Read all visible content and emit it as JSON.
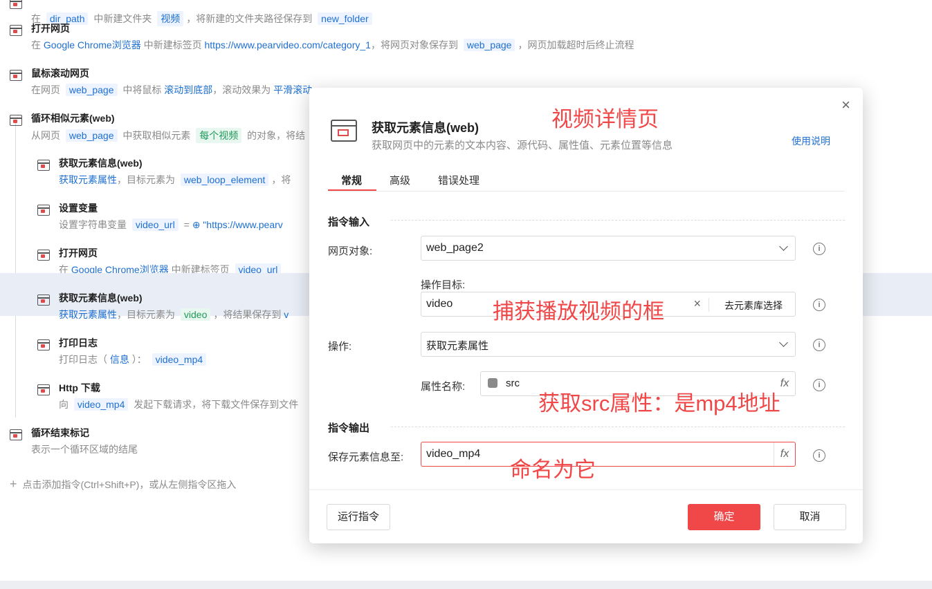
{
  "steps": [
    {
      "title": "",
      "desc": [
        {
          "t": "在 "
        },
        {
          "tag": "dir_path"
        },
        {
          "t": " 中新建文件夹 "
        },
        {
          "tag": "视频"
        },
        {
          "t": "，将新建的文件夹路径保存到 "
        },
        {
          "tag": "new_folder"
        }
      ]
    },
    {
      "title": "打开网页",
      "desc": [
        {
          "t": "在 "
        },
        {
          "lnk": "Google Chrome浏览器"
        },
        {
          "t": " 中新建标签页 "
        },
        {
          "lnk": "https://www.pearvideo.com/category_1"
        },
        {
          "t": "，将网页对象保存到 "
        },
        {
          "tag": "web_page"
        },
        {
          "t": "，网页加载超时后终止流程"
        }
      ]
    },
    {
      "title": "鼠标滚动网页",
      "desc": [
        {
          "t": "在网页 "
        },
        {
          "tag": "web_page"
        },
        {
          "t": " 中将鼠标 "
        },
        {
          "lnk": "滚动到底部"
        },
        {
          "t": "，滚动效果为 "
        },
        {
          "lnk": "平滑滚动"
        }
      ]
    },
    {
      "title": "循环相似元素(web)",
      "desc": [
        {
          "t": "从网页 "
        },
        {
          "tag": "web_page"
        },
        {
          "t": " 中获取相似元素 "
        },
        {
          "tagg": "每个视频"
        },
        {
          "t": " 的对象，将结"
        }
      ]
    },
    {
      "title": "获取元素信息(web)",
      "desc": [
        {
          "lnk": "获取元素属性"
        },
        {
          "t": "，目标元素为 "
        },
        {
          "tag": "web_loop_element"
        },
        {
          "t": "，将"
        }
      ]
    },
    {
      "title": "设置变量",
      "desc": [
        {
          "t": "设置字符串变量 "
        },
        {
          "tag": "video_url"
        },
        {
          "t": " = "
        },
        {
          "lnk": "⊕ \"https://www.pearv"
        }
      ]
    },
    {
      "title": "打开网页",
      "desc": [
        {
          "t": "在 "
        },
        {
          "lnk": "Google Chrome浏览器"
        },
        {
          "t": " 中新建标签页 "
        },
        {
          "tag": "video_url"
        }
      ]
    },
    {
      "title": "获取元素信息(web)",
      "desc": [
        {
          "lnk": "获取元素属性"
        },
        {
          "t": "，目标元素为 "
        },
        {
          "tagg": "video"
        },
        {
          "t": "，将结果保存到 "
        },
        {
          "lnk": "v"
        }
      ]
    },
    {
      "title": "打印日志",
      "desc": [
        {
          "t": "打印日志（ "
        },
        {
          "lnk": "信息"
        },
        {
          "t": " ）： "
        },
        {
          "tag": "video_mp4"
        }
      ]
    },
    {
      "title": "Http 下载",
      "desc": [
        {
          "t": "向 "
        },
        {
          "tag": "video_mp4"
        },
        {
          "t": " 发起下载请求，将下载文件保存到文件"
        }
      ]
    },
    {
      "title": "循环结束标记",
      "desc": [
        {
          "t": "表示一个循环区域的结尾"
        }
      ]
    }
  ],
  "add_hint": "点击添加指令(Ctrl+Shift+P)，或从左侧指令区拖入",
  "modal": {
    "title": "获取元素信息(web)",
    "subtitle": "获取网页中的元素的文本内容、源代码、属性值、元素位置等信息",
    "help": "使用说明",
    "close": "×",
    "tabs": [
      "常规",
      "高级",
      "错误处理"
    ],
    "section_input": "指令输入",
    "web_label": "网页对象:",
    "web_value": "web_page2",
    "target_label": "操作目标:",
    "target_value": "video",
    "target_btn": "去元素库选择",
    "op_label": "操作:",
    "op_value": "获取元素属性",
    "attr_label": "属性名称:",
    "attr_value": "src",
    "section_output": "指令输出",
    "save_label": "保存元素信息至:",
    "save_value": "video_mp4",
    "run_btn": "运行指令",
    "ok_btn": "确定",
    "cancel_btn": "取消"
  },
  "annotations": {
    "detail_page": "视频详情页",
    "capture": "捕获播放视频的框",
    "src_attr": "获取src属性：是mp4地址",
    "naming": "命名为它"
  },
  "colors": {
    "accent": "#f04848",
    "link": "#1d6fd1"
  }
}
